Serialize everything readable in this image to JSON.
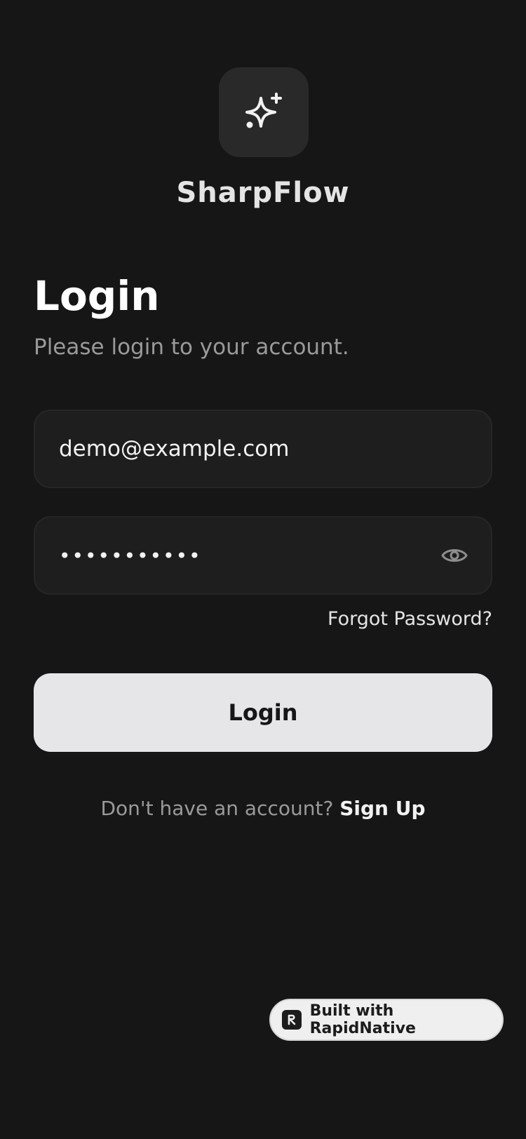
{
  "app": {
    "name": "SharpFlow",
    "logo_icon": "sparkles-icon"
  },
  "login": {
    "title": "Login",
    "subtitle": "Please login to your account.",
    "email": {
      "value": "demo@example.com"
    },
    "password": {
      "value": "•••••••••••",
      "toggle_icon": "eye-icon"
    },
    "forgot_label": "Forgot Password?",
    "submit_label": "Login",
    "signup_prompt": "Don't have an account?",
    "signup_label": "Sign Up"
  },
  "badge": {
    "label": "Built with RapidNative",
    "icon": "rapidnative-logo-icon"
  },
  "colors": {
    "background": "#161616",
    "field": "#1e1e1e",
    "button": "#e6e6e8",
    "text_primary": "#ffffff",
    "text_secondary": "#9a9a9a"
  }
}
